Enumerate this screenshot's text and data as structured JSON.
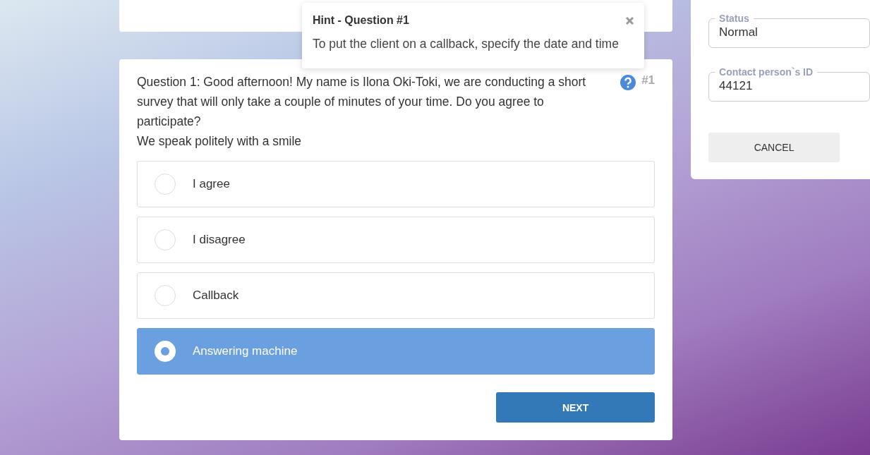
{
  "hint": {
    "title": "Hint - Question #1",
    "text": "To put the client on a callback, specify the date and time"
  },
  "question": {
    "text": "Question 1: Good afternoon! My name is Ilona Oki-Toki, we are conducting a short survey that will only take a couple of minutes of your time. Do you agree to participate?",
    "note": "We speak politely with a smile",
    "number": "#1"
  },
  "answers": [
    {
      "label": "I agree",
      "selected": false
    },
    {
      "label": "I disagree",
      "selected": false
    },
    {
      "label": "Callback",
      "selected": false
    },
    {
      "label": "Answering machine",
      "selected": true
    }
  ],
  "next_button": "NEXT",
  "side_panel": {
    "fields": [
      {
        "label": "Status",
        "value": "Normal"
      },
      {
        "label": "Contact person`s ID",
        "value": "44121"
      }
    ],
    "cancel_button": "CANCEL"
  }
}
